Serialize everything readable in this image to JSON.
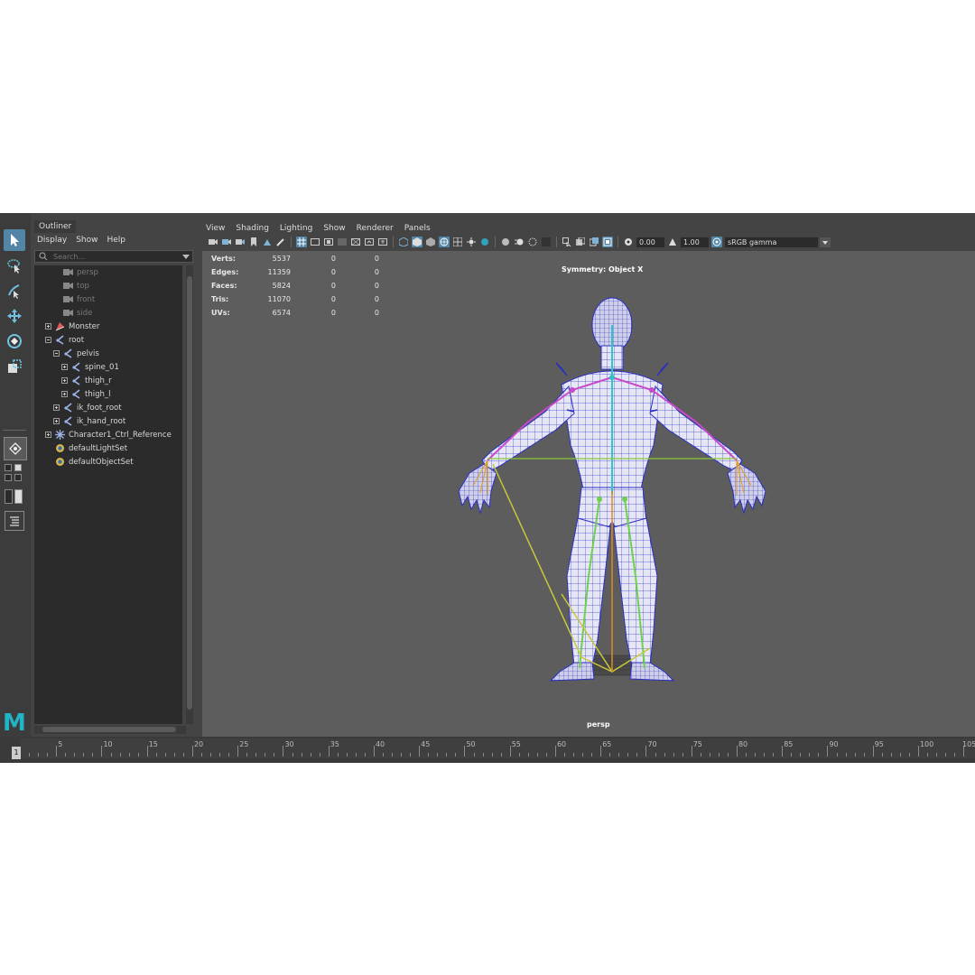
{
  "outliner": {
    "tab": "Outliner",
    "menu": [
      "Display",
      "Show",
      "Help"
    ],
    "search_placeholder": "Search...",
    "items": [
      {
        "label": "persp",
        "icon": "camera-icon",
        "depth": 2,
        "dim": true,
        "expander": "none"
      },
      {
        "label": "top",
        "icon": "camera-icon",
        "depth": 2,
        "dim": true,
        "expander": "none"
      },
      {
        "label": "front",
        "icon": "camera-icon",
        "depth": 2,
        "dim": true,
        "expander": "none"
      },
      {
        "label": "side",
        "icon": "camera-icon",
        "depth": 2,
        "dim": true,
        "expander": "none"
      },
      {
        "label": "Monster",
        "icon": "mesh-icon",
        "depth": 1,
        "dim": false,
        "expander": "plus"
      },
      {
        "label": "root",
        "icon": "joint-icon",
        "depth": 1,
        "dim": false,
        "expander": "minus"
      },
      {
        "label": "pelvis",
        "icon": "joint-icon",
        "depth": 2,
        "dim": false,
        "expander": "minus"
      },
      {
        "label": "spine_01",
        "icon": "joint-icon",
        "depth": 3,
        "dim": false,
        "expander": "plus"
      },
      {
        "label": "thigh_r",
        "icon": "joint-icon",
        "depth": 3,
        "dim": false,
        "expander": "plus"
      },
      {
        "label": "thigh_l",
        "icon": "joint-icon",
        "depth": 3,
        "dim": false,
        "expander": "plus"
      },
      {
        "label": "ik_foot_root",
        "icon": "joint-icon",
        "depth": 2,
        "dim": false,
        "expander": "plus"
      },
      {
        "label": "ik_hand_root",
        "icon": "joint-icon",
        "depth": 2,
        "dim": false,
        "expander": "plus"
      },
      {
        "label": "Character1_Ctrl_Reference",
        "icon": "hik-icon",
        "depth": 1,
        "dim": false,
        "expander": "plus"
      },
      {
        "label": "defaultLightSet",
        "icon": "set-icon",
        "depth": 1,
        "dim": false,
        "expander": "none"
      },
      {
        "label": "defaultObjectSet",
        "icon": "set-icon",
        "depth": 1,
        "dim": false,
        "expander": "none"
      }
    ]
  },
  "viewport": {
    "menu": [
      "View",
      "Shading",
      "Lighting",
      "Show",
      "Renderer",
      "Panels"
    ],
    "exposure": "0.00",
    "gamma": "1.00",
    "color_space": "sRGB gamma",
    "symmetry": "Symmetry: Object X",
    "camera": "persp",
    "hud": [
      {
        "label": "Verts:",
        "v1": "5537",
        "v2": "0",
        "v3": "0"
      },
      {
        "label": "Edges:",
        "v1": "11359",
        "v2": "0",
        "v3": "0"
      },
      {
        "label": "Faces:",
        "v1": "5824",
        "v2": "0",
        "v3": "0"
      },
      {
        "label": "Tris:",
        "v1": "11070",
        "v2": "0",
        "v3": "0"
      },
      {
        "label": "UVs:",
        "v1": "6574",
        "v2": "0",
        "v3": "0"
      }
    ]
  },
  "timeline": {
    "current_frame": "1",
    "labels": [
      "5",
      "10",
      "15",
      "20",
      "25",
      "30",
      "35",
      "40",
      "45",
      "50",
      "55",
      "60",
      "65",
      "70",
      "75",
      "80",
      "85",
      "90",
      "95",
      "100",
      "105"
    ]
  },
  "logo": "M",
  "colors": {
    "accent": "#5285a6",
    "logo": "#1fb5c6",
    "wire": "#3a3fd0",
    "skeleton_yellow": "#c8c83a"
  }
}
